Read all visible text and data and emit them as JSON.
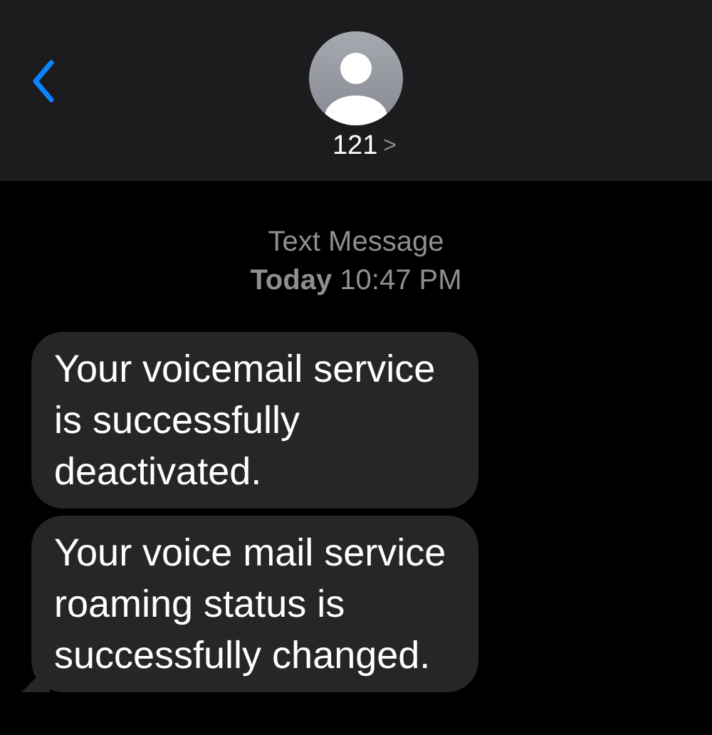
{
  "header": {
    "contact": "121",
    "chevron": ">"
  },
  "timestamp": {
    "label": "Text Message",
    "time": "**Today** 10:47 PM"
  },
  "messages": [
    {
      "text": "Your voicemail service is successfully deactivated.",
      "tail": false
    },
    {
      "text": "Your voice mail service roaming status is successfully changed.",
      "tail": true
    }
  ]
}
